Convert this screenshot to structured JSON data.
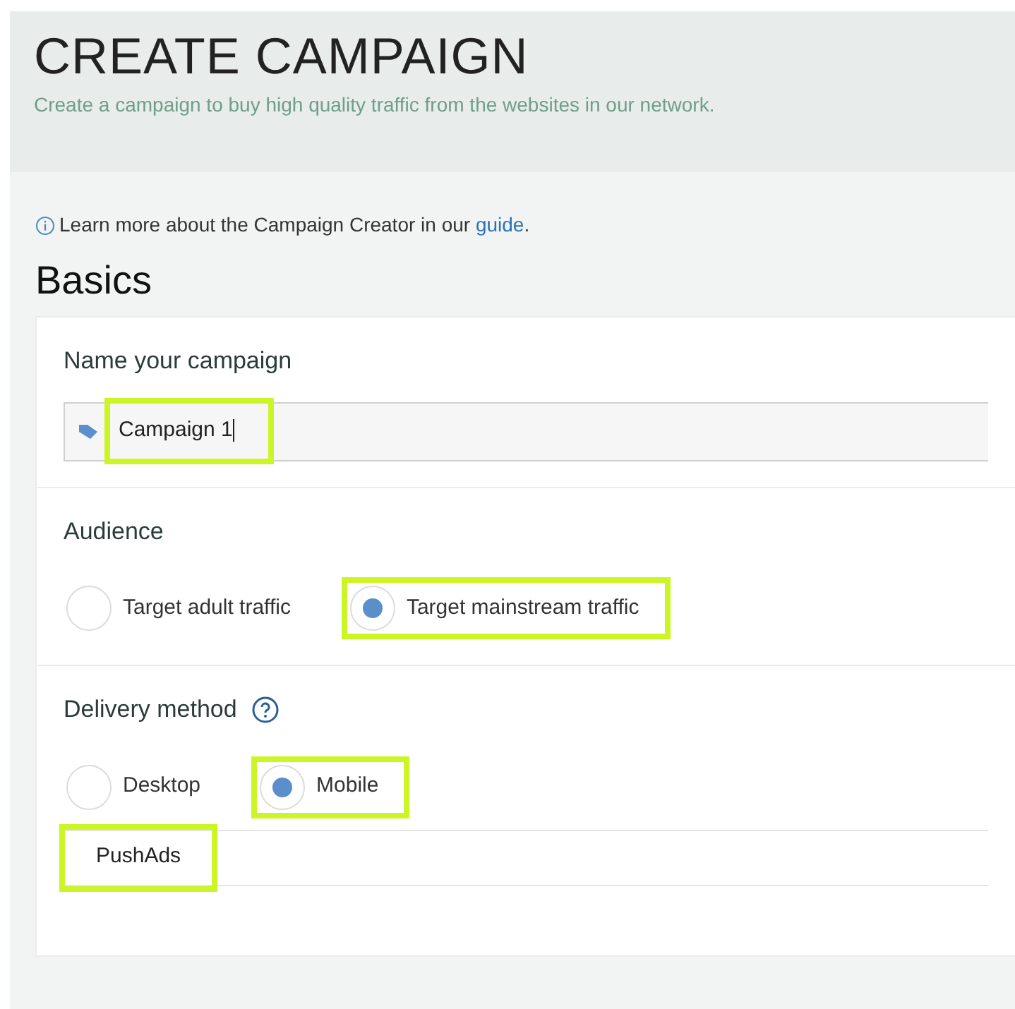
{
  "header": {
    "title": "CREATE CAMPAIGN",
    "subtitle": "Create a campaign to buy high quality traffic from the websites in our network."
  },
  "info": {
    "text": "Learn more about the Campaign Creator in our",
    "link": "guide",
    "after": "."
  },
  "section_title": "Basics",
  "name_section": {
    "label": "Name your campaign",
    "value": "Campaign 1",
    "highlighted": true
  },
  "audience": {
    "label": "Audience",
    "options": [
      {
        "label": "Target adult traffic",
        "selected": false,
        "highlighted": false
      },
      {
        "label": "Target mainstream traffic",
        "selected": true,
        "highlighted": true
      }
    ]
  },
  "delivery": {
    "label": "Delivery method",
    "options": [
      {
        "label": "Desktop",
        "selected": false,
        "highlighted": false
      },
      {
        "label": "Mobile",
        "selected": true,
        "highlighted": true
      }
    ],
    "format": {
      "label": "PushAds",
      "highlighted": true
    }
  }
}
